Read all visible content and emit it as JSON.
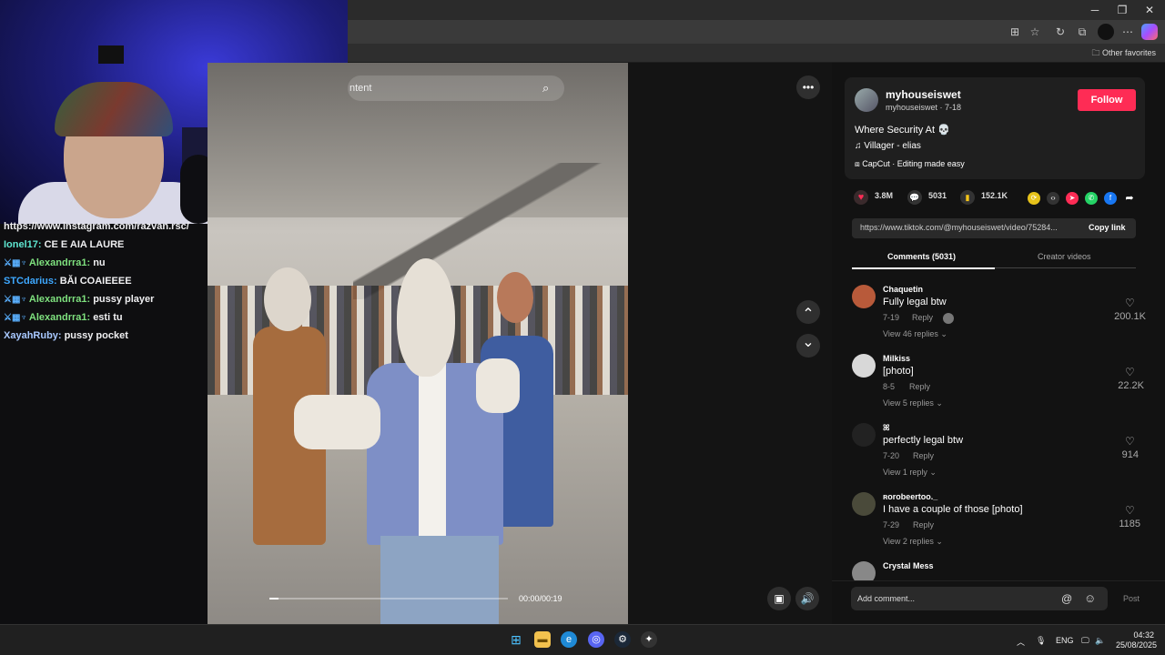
{
  "browser": {
    "minimize": "─",
    "restore": "❐",
    "close": "✕",
    "other_favorites": "Other favorites"
  },
  "stream_chat": {
    "messages": [
      {
        "user": "",
        "text": "https://www.instagram.com/razvan.rsc/",
        "user_color": "#efeff1"
      },
      {
        "user": "Ionel17:",
        "text": "CE E AIA LAURE",
        "user_color": "#5ee6d0"
      },
      {
        "badges": "⚔▦♆",
        "user": "Alexandrra1:",
        "text": "nu",
        "user_color": "#7ee07e"
      },
      {
        "user": "STCdarius:",
        "text": "BĂI COAIEEEE",
        "user_color": "#3ea8ff"
      },
      {
        "badges": "⚔▦♆",
        "user": "Alexandrra1:",
        "text": "pussy player",
        "user_color": "#7ee07e"
      },
      {
        "badges": "⚔▦♆",
        "user": "Alexandrra1:",
        "text": "esti tu",
        "user_color": "#7ee07e"
      },
      {
        "user": "XayahRuby:",
        "text": "pussy pocket",
        "user_color": "#a8c8ff"
      }
    ]
  },
  "video": {
    "search_text": "ntent",
    "time": "00:00/00:19",
    "progress": 0.04,
    "more_icon": "•••",
    "up_icon": "⌃",
    "down_icon": "⌄",
    "mini_icon": "▣",
    "volume_icon": "🔊"
  },
  "post": {
    "username": "myhouseiswet",
    "handle": "myhouseiswet · 7-18",
    "follow_label": "Follow",
    "description": "Where Security At 💀",
    "music": "♫  Villager - elias",
    "capcut": "CapCut · Editing made easy",
    "likes": "3.8M",
    "comments": "5031",
    "saves": "152.1K",
    "url": "https://www.tiktok.com/@myhouseiswet/video/75284...",
    "copy_label": "Copy link",
    "tab_comments": "Comments (5031)",
    "tab_creator": "Creator videos",
    "accent": "#fe2c55"
  },
  "comments": [
    {
      "user": "Chaquetin",
      "text": "Fully legal btw",
      "date": "7-19",
      "reply": "Reply",
      "view": "View 46 replies ⌄",
      "likes": "200.1K"
    },
    {
      "user": "Milkiss",
      "text": "[photo]",
      "date": "8-5",
      "reply": "Reply",
      "view": "View 5 replies ⌄",
      "likes": "22.2K"
    },
    {
      "user": "ꕤ",
      "text": "perfectly legal btw",
      "date": "7-20",
      "reply": "Reply",
      "view": "View 1 reply ⌄",
      "likes": "914"
    },
    {
      "user": "ʀorobeertoo._",
      "text": "I have a couple of those [photo]",
      "date": "7-29",
      "reply": "Reply",
      "view": "View 2 replies ⌄",
      "likes": "1185"
    },
    {
      "user": "Crystal Mess",
      "text": "",
      "date": "",
      "reply": "",
      "view": "",
      "likes": ""
    }
  ],
  "comment_box": {
    "placeholder": "Add comment...",
    "post_label": "Post"
  },
  "taskbar": {
    "lang": "ENG",
    "time": "04:32",
    "date": "25/08/2025"
  }
}
